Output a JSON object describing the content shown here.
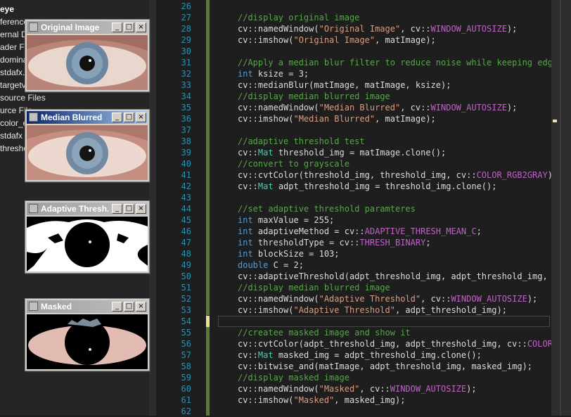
{
  "explorer": {
    "items": [
      "eye",
      "ferences",
      "ernal De",
      "ader File",
      "dominan",
      "stdafx.",
      "targetv",
      "source Files",
      "urce File",
      "color_e",
      "stdafx",
      "thresho"
    ]
  },
  "windows": {
    "original": {
      "title": "Original Image"
    },
    "median": {
      "title": "Median Blurred"
    },
    "adaptive": {
      "title": "Adaptive Thresh..."
    },
    "masked": {
      "title": "Masked"
    },
    "controls": {
      "minimize": "_",
      "maximize": "□",
      "close": "×"
    }
  },
  "code_lines": [
    {
      "n": "26",
      "segs": []
    },
    {
      "n": "27",
      "segs": [
        [
          "cm",
          "//display original image"
        ]
      ]
    },
    {
      "n": "28",
      "segs": [
        [
          "",
          "cv::namedWindow("
        ],
        [
          "st",
          "\"Original Image\""
        ],
        [
          "",
          ", cv::"
        ],
        [
          "cn",
          "WINDOW_AUTOSIZE"
        ],
        [
          "",
          ");"
        ]
      ]
    },
    {
      "n": "29",
      "segs": [
        [
          "",
          "cv::imshow("
        ],
        [
          "st",
          "\"Original Image\""
        ],
        [
          "",
          ", matImage);"
        ]
      ]
    },
    {
      "n": "30",
      "segs": []
    },
    {
      "n": "31",
      "segs": [
        [
          "cm",
          "//Apply a median blur filter to reduce noise while keeping edges"
        ]
      ]
    },
    {
      "n": "32",
      "segs": [
        [
          "kw",
          "int"
        ],
        [
          "",
          " ksize = 3;"
        ]
      ]
    },
    {
      "n": "33",
      "segs": [
        [
          "",
          "cv::medianBlur(matImage, matImage, ksize);"
        ]
      ]
    },
    {
      "n": "34",
      "segs": [
        [
          "cm",
          "//display median blurred image"
        ]
      ]
    },
    {
      "n": "35",
      "segs": [
        [
          "",
          "cv::namedWindow("
        ],
        [
          "st",
          "\"Median Blurred\""
        ],
        [
          "",
          ", cv::"
        ],
        [
          "cn",
          "WINDOW_AUTOSIZE"
        ],
        [
          "",
          ");"
        ]
      ]
    },
    {
      "n": "36",
      "segs": [
        [
          "",
          "cv::imshow("
        ],
        [
          "st",
          "\"Median Blurred\""
        ],
        [
          "",
          ", matImage);"
        ]
      ]
    },
    {
      "n": "37",
      "segs": []
    },
    {
      "n": "38",
      "segs": [
        [
          "cm",
          "//adaptive threshold test"
        ]
      ]
    },
    {
      "n": "39",
      "segs": [
        [
          "",
          "cv::"
        ],
        [
          "ns",
          "Mat"
        ],
        [
          "",
          " threshold_img = matImage.clone();"
        ]
      ]
    },
    {
      "n": "40",
      "segs": [
        [
          "cm",
          "//convert to grayscale"
        ]
      ]
    },
    {
      "n": "41",
      "segs": [
        [
          "",
          "cv::cvtColor(threshold_img, threshold_img, cv::"
        ],
        [
          "cn",
          "COLOR_RGB2GRAY"
        ],
        [
          "",
          ");"
        ]
      ]
    },
    {
      "n": "42",
      "segs": [
        [
          "",
          "cv::"
        ],
        [
          "ns",
          "Mat"
        ],
        [
          "",
          " adpt_threshold_img = threshold_img.clone();"
        ]
      ]
    },
    {
      "n": "43",
      "segs": []
    },
    {
      "n": "44",
      "segs": [
        [
          "cm",
          "//set adaptive threshold paramteres"
        ]
      ]
    },
    {
      "n": "45",
      "segs": [
        [
          "kw",
          "int"
        ],
        [
          "",
          " maxValue = 255;"
        ]
      ]
    },
    {
      "n": "46",
      "segs": [
        [
          "kw",
          "int"
        ],
        [
          "",
          " adaptiveMethod = cv::"
        ],
        [
          "cn",
          "ADAPTIVE_THRESH_MEAN_C"
        ],
        [
          "",
          ";"
        ]
      ]
    },
    {
      "n": "47",
      "segs": [
        [
          "kw",
          "int"
        ],
        [
          "",
          " thresholdType = cv::"
        ],
        [
          "cn",
          "THRESH_BINARY"
        ],
        [
          "",
          ";"
        ]
      ]
    },
    {
      "n": "48",
      "segs": [
        [
          "kw",
          "int"
        ],
        [
          "",
          " blockSize = 103;"
        ]
      ]
    },
    {
      "n": "49",
      "segs": [
        [
          "kw",
          "double"
        ],
        [
          "",
          " C = 2;"
        ]
      ]
    },
    {
      "n": "50",
      "segs": [
        [
          "",
          "cv::adaptiveThreshold(adpt_threshold_img, adpt_threshold_img, ma"
        ]
      ]
    },
    {
      "n": "51",
      "segs": [
        [
          "cm",
          "//display median blurred image"
        ]
      ]
    },
    {
      "n": "52",
      "segs": [
        [
          "",
          "cv::namedWindow("
        ],
        [
          "st",
          "\"Adaptive Threshold\""
        ],
        [
          "",
          ", cv::"
        ],
        [
          "cn",
          "WINDOW_AUTOSIZE"
        ],
        [
          "",
          ");"
        ]
      ]
    },
    {
      "n": "53",
      "segs": [
        [
          "",
          "cv::imshow("
        ],
        [
          "st",
          "\"Adaptive Threshold\""
        ],
        [
          "",
          ", adpt_threshold_img);"
        ]
      ]
    },
    {
      "n": "54",
      "segs": []
    },
    {
      "n": "55",
      "segs": [
        [
          "cm",
          "//createe masked image and show it"
        ]
      ]
    },
    {
      "n": "56",
      "segs": [
        [
          "",
          "cv::cvtColor(adpt_threshold_img, adpt_threshold_img, cv::"
        ],
        [
          "cn",
          "COLOR_G"
        ]
      ]
    },
    {
      "n": "57",
      "segs": [
        [
          "",
          "cv::"
        ],
        [
          "ns",
          "Mat"
        ],
        [
          "",
          " masked_img = adpt_threshold_img.clone();"
        ]
      ]
    },
    {
      "n": "58",
      "segs": [
        [
          "",
          "cv::bitwise_and(matImage, adpt_threshold_img, masked_img);"
        ]
      ]
    },
    {
      "n": "59",
      "segs": [
        [
          "cm",
          "//display masked image"
        ]
      ]
    },
    {
      "n": "60",
      "segs": [
        [
          "",
          "cv::namedWindow("
        ],
        [
          "st",
          "\"Masked\""
        ],
        [
          "",
          ", cv::"
        ],
        [
          "cn",
          "WINDOW_AUTOSIZE"
        ],
        [
          "",
          ");"
        ]
      ]
    },
    {
      "n": "61",
      "segs": [
        [
          "",
          "cv::imshow("
        ],
        [
          "st",
          "\"Masked\""
        ],
        [
          "",
          ", masked_img);"
        ]
      ]
    },
    {
      "n": "62",
      "segs": []
    }
  ],
  "colors": {
    "comment": "#57a64a",
    "keyword": "#569cd6",
    "string": "#d69d85",
    "type": "#4ec9b0",
    "constant": "#bd63c5",
    "line_number": "#2b91af",
    "editor_bg": "#1e1e1e",
    "active_title": "#0a246a"
  }
}
